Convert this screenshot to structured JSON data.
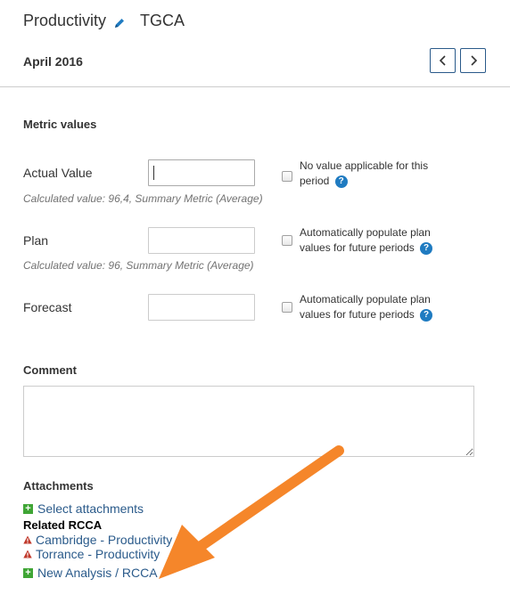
{
  "header": {
    "title": "Productivity",
    "subtitle": "TGCA",
    "period": "April 2016"
  },
  "metric_values": {
    "section_title": "Metric values",
    "actual": {
      "label": "Actual Value",
      "value": "",
      "checkbox_text": "No value applicable for this period",
      "calculated": "Calculated value: 96,4, Summary Metric (Average)"
    },
    "plan": {
      "label": "Plan",
      "value": "",
      "checkbox_text": "Automatically populate plan values for future periods",
      "calculated": "Calculated value: 96, Summary Metric (Average)"
    },
    "forecast": {
      "label": "Forecast",
      "value": "",
      "checkbox_text": "Automatically populate plan values for future periods"
    }
  },
  "comment": {
    "label": "Comment",
    "value": ""
  },
  "attachments": {
    "label": "Attachments",
    "select_link": "Select attachments"
  },
  "related": {
    "label": "Related RCCA",
    "items": [
      {
        "label": "Cambridge - Productivity"
      },
      {
        "label": "Torrance - Productivity"
      }
    ],
    "new_link": "New Analysis / RCCA"
  },
  "colors": {
    "link": "#2b5b8b",
    "help": "#1f7bc1",
    "plus": "#3fa535",
    "warning": "#c0392b",
    "annotation_arrow": "#f5862a"
  },
  "icons": {
    "edit": "pencil-icon",
    "prev": "chevron-left-icon",
    "next": "chevron-right-icon",
    "help": "question-circle-icon",
    "add": "plus-square-icon",
    "warning": "warning-triangle-icon"
  },
  "help_glyph": "?",
  "plus_glyph": "+"
}
